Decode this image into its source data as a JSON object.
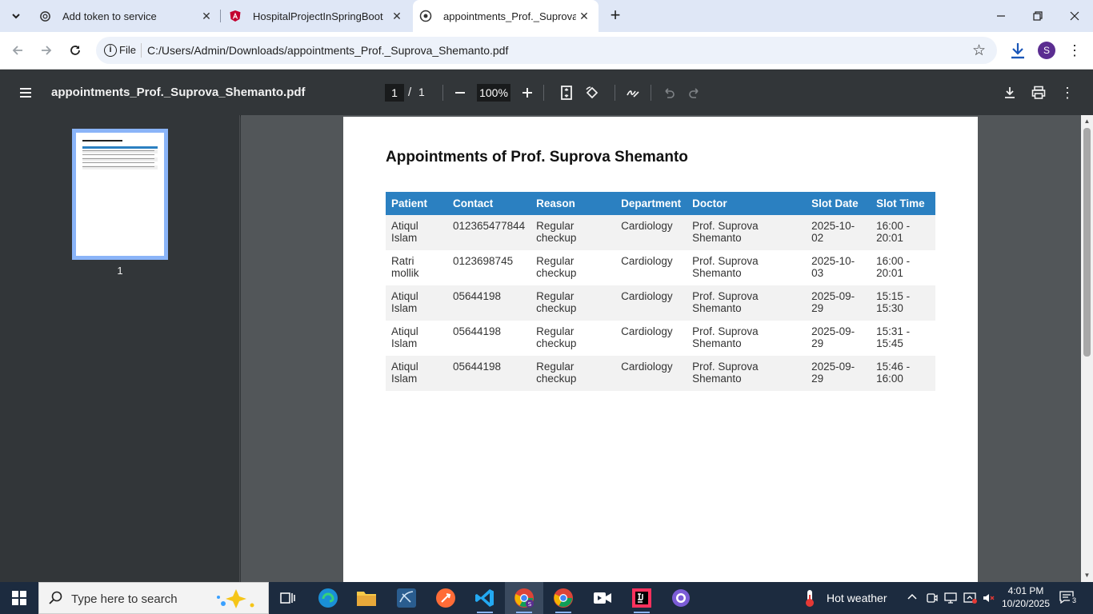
{
  "tabs": [
    {
      "title": "Add token to service",
      "icon": "openai-icon"
    },
    {
      "title": "HospitalProjectInSpringBoot",
      "icon": "angular-icon"
    },
    {
      "title": "appointments_Prof._Suprova_Shemanto.pdf",
      "icon": "globe-icon"
    }
  ],
  "omnibox": {
    "scheme_label": "File",
    "url": "C:/Users/Admin/Downloads/appointments_Prof._Suprova_Shemanto.pdf"
  },
  "profile": {
    "initial": "S"
  },
  "pdf_toolbar": {
    "filename": "appointments_Prof._Suprova_Shemanto.pdf",
    "page_current": "1",
    "page_separator": "/",
    "page_total": "1",
    "zoom": "100%"
  },
  "thumbnail": {
    "page_number": "1"
  },
  "document": {
    "title": "Appointments of Prof. Suprova Shemanto",
    "header_color": "#2b80c1",
    "columns": [
      "Patient",
      "Contact",
      "Reason",
      "Department",
      "Doctor",
      "Slot Date",
      "Slot Time"
    ],
    "rows": [
      [
        "Atiqul Islam",
        "012365477844",
        "Regular checkup",
        "Cardiology",
        "Prof. Suprova Shemanto",
        "2025-10-02",
        "16:00 - 20:01"
      ],
      [
        "Ratri mollik",
        "0123698745",
        "Regular checkup",
        "Cardiology",
        "Prof. Suprova Shemanto",
        "2025-10-03",
        "16:00 - 20:01"
      ],
      [
        "Atiqul Islam",
        "05644198",
        "Regular checkup",
        "Cardiology",
        "Prof. Suprova Shemanto",
        "2025-09-29",
        "15:15 - 15:30"
      ],
      [
        "Atiqul Islam",
        "05644198",
        "Regular checkup",
        "Cardiology",
        "Prof. Suprova Shemanto",
        "2025-09-29",
        "15:31 - 15:45"
      ],
      [
        "Atiqul Islam",
        "05644198",
        "Regular checkup",
        "Cardiology",
        "Prof. Suprova Shemanto",
        "2025-09-29",
        "15:46 - 16:00"
      ]
    ]
  },
  "taskbar": {
    "search_placeholder": "Type here to search",
    "weather": "Hot weather",
    "time": "4:01 PM",
    "date": "10/20/2025",
    "notification_count": "3"
  }
}
